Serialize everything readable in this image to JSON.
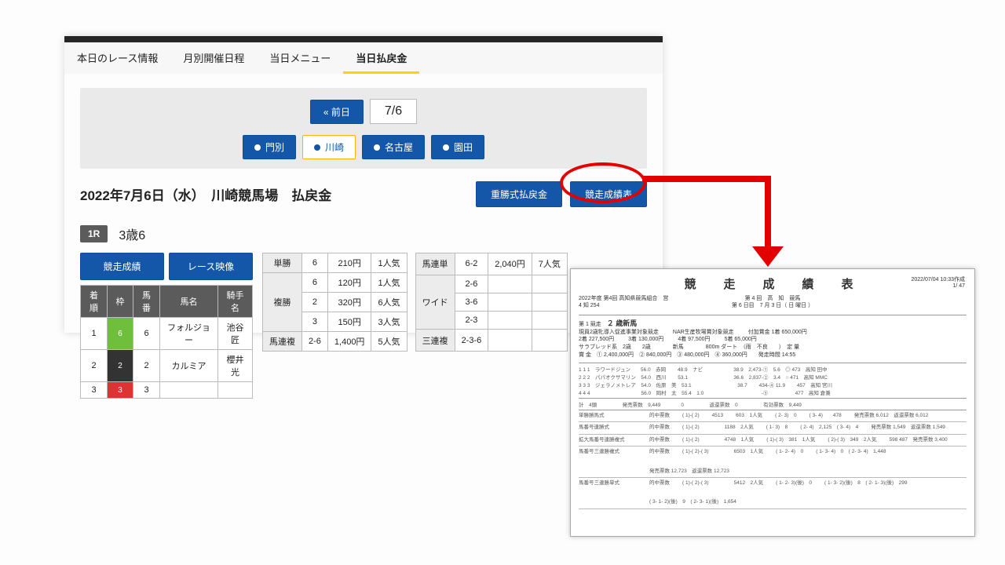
{
  "tabs": [
    "本日のレース情報",
    "月別開催日程",
    "当日メニュー",
    "当日払戻金"
  ],
  "active_tab": 3,
  "datebar": {
    "prev": "« 前日",
    "date": "7/6"
  },
  "venues": [
    "門別",
    "川崎",
    "名古屋",
    "園田"
  ],
  "active_venue": 1,
  "page_title": "2022年7月6日（水）　川崎競馬場　払戻金",
  "meta_buttons": {
    "kachi": "重勝式払戻金",
    "seiseki": "競走成績表"
  },
  "race": {
    "badge": "1R",
    "name": "3歳6"
  },
  "twin_buttons": {
    "left": "競走成績",
    "right": "レース映像"
  },
  "finish_headers": [
    "着順",
    "枠",
    "馬番",
    "馬名",
    "騎手名"
  ],
  "finish_rows": [
    {
      "rank": "1",
      "waku": "6",
      "waku_cls": "waku-g",
      "num": "6",
      "horse": "フォルジョー",
      "jockey": "池谷匠"
    },
    {
      "rank": "2",
      "waku": "2",
      "waku_cls": "waku-k",
      "num": "2",
      "horse": "カルミア",
      "jockey": "櫻井光"
    },
    {
      "rank": "3",
      "waku": "3",
      "waku_cls": "waku-r",
      "num": "3",
      "horse": "",
      "jockey": ""
    }
  ],
  "pay_left": {
    "rows": [
      {
        "type": "単勝",
        "cells": [
          [
            "6",
            "210円",
            "1人気"
          ]
        ]
      },
      {
        "type": "複勝",
        "cells": [
          [
            "6",
            "120円",
            "1人気"
          ],
          [
            "2",
            "320円",
            "6人気"
          ],
          [
            "3",
            "150円",
            "3人気"
          ]
        ]
      },
      {
        "type": "馬連複",
        "cells": [
          [
            "2-6",
            "1,400円",
            "5人気"
          ]
        ]
      }
    ]
  },
  "pay_right": {
    "rows": [
      {
        "type": "馬連単",
        "cells": [
          [
            "6-2",
            "2,040円",
            "7人気"
          ]
        ]
      },
      {
        "type": "ワイド",
        "cells": [
          [
            "2-6",
            "",
            ""
          ],
          [
            "3-6",
            "",
            ""
          ],
          [
            "2-3",
            "",
            ""
          ]
        ]
      },
      {
        "type": "三連複",
        "cells": [
          [
            "2-3-6",
            "",
            ""
          ]
        ]
      }
    ]
  },
  "doc": {
    "title": "競　走　成　績　表",
    "timestamp": "2022/07/04 10:33作成",
    "page": "1/ 47",
    "org_line1": "2022年度 第4回 高知県競馬組合　営",
    "org_line2": "4 知 254",
    "day_line": "第 6 日目　7 月 3 日（ 日 曜日 ）",
    "meet": "第 4 回　高　知　競馬",
    "race_no": "第 1 競走",
    "race_name": "２ 歳新馬",
    "conds": [
      "現員2歳牝導入促進事業対象競走",
      "NAR生産牧場賞対象競走",
      "付加賞金 1着 650,000円"
    ],
    "prizes": [
      "2着 227,500円",
      "3着 130,000円",
      "4着 97,500円",
      "5着 65,000円"
    ],
    "class_line": "サラブレッド系　2歳　　2歳　　　　新馬　　　　800m ダート　（雨　不良　　）　定 量",
    "purse_line": "賞 金　① 2,400,000円　② 840,000円　③ 480,000円　④ 360,000円　　発走時間 14:55",
    "horses": [
      "1 1 1　ラワードジュン　　56.0　赤岡　 　48.9　ナビ　　　　　　38.9　2,473-①　5.6　◎ 473　高知 田中",
      "2 2 2　パパオクサマリン　54.0　西川　 　53.1　　　　　　　　　36.6　2,837-②　3.4　○ 471　高知 MMC",
      "3 3 3　ジェラノメトレア　54.0　佐原　美　53.1　　　　　　　　　38.7　　 434-④ 11.9　　 457　高知 宮川",
      "4 4 4　　　　　　　　　　56.0　岡村　太　55.4　1.0　　　　　　　　　　　 -③　　　　　 477　高知 倉兼"
    ],
    "total_line": "計　4頭　　　　　発売票数　9,449　　　　0　　　　　返還票数　0　　　　　有効票数　9,449",
    "bet_blocks": [
      {
        "lbl": "単勝勝馬式",
        "hits": "的中票数",
        "combo": "( 1)-( 2)",
        "val": "4513",
        "pop": "603　1人気",
        "extra": "( 2- 3)　0",
        "more": "( 3- 4)　　478",
        "more2": "発売票数  6,012　返還票数  6,012"
      },
      {
        "lbl": "馬番号連勝式",
        "hits": "的中票数",
        "combo": "( 1)-( 2)",
        "val": "",
        "pop": "1188　2人気",
        "extra": "( 1- 3)　8",
        "more": "( 2- 4)　2,125　( 3- 4)　4",
        "more2": "発売票数  1,549　返還票数  1,549"
      },
      {
        "lbl": "拡大馬番号連勝複式",
        "hits": "的中票数",
        "combo": "( 1)-( 2)",
        "val": "",
        "pop": "4748　1人気",
        "extra": "( 1)-( 3)　381　1人気",
        "more": "( 2)-( 3)　349　2人気",
        "more2": "598 487　発売票数  3,400"
      },
      {
        "lbl": "馬番号三連勝複式",
        "hits": "的中票数",
        "combo": "( 1)-( 2)-( 3)",
        "val": "",
        "pop": "6503　1人気",
        "extra": "( 1- 2- 4)　0",
        "more": "( 1- 3- 4)　0　( 2- 3- 4)　1,448",
        "more2": "発売票数  12,723　返還票数  12,723"
      },
      {
        "lbl": "馬番号三連勝単式",
        "hits": "的中票数",
        "combo": "( 1)-( 2)-( 3)",
        "val": "",
        "pop": "5412　2人気",
        "extra": "( 1- 2- 3)(後)　0",
        "more": "( 1- 3- 2)(後)　8　( 2- 1- 3)(後)　299",
        "more2": "( 3- 1- 2)(後)　9　( 2- 3- 1)(後)　1,654"
      }
    ]
  }
}
